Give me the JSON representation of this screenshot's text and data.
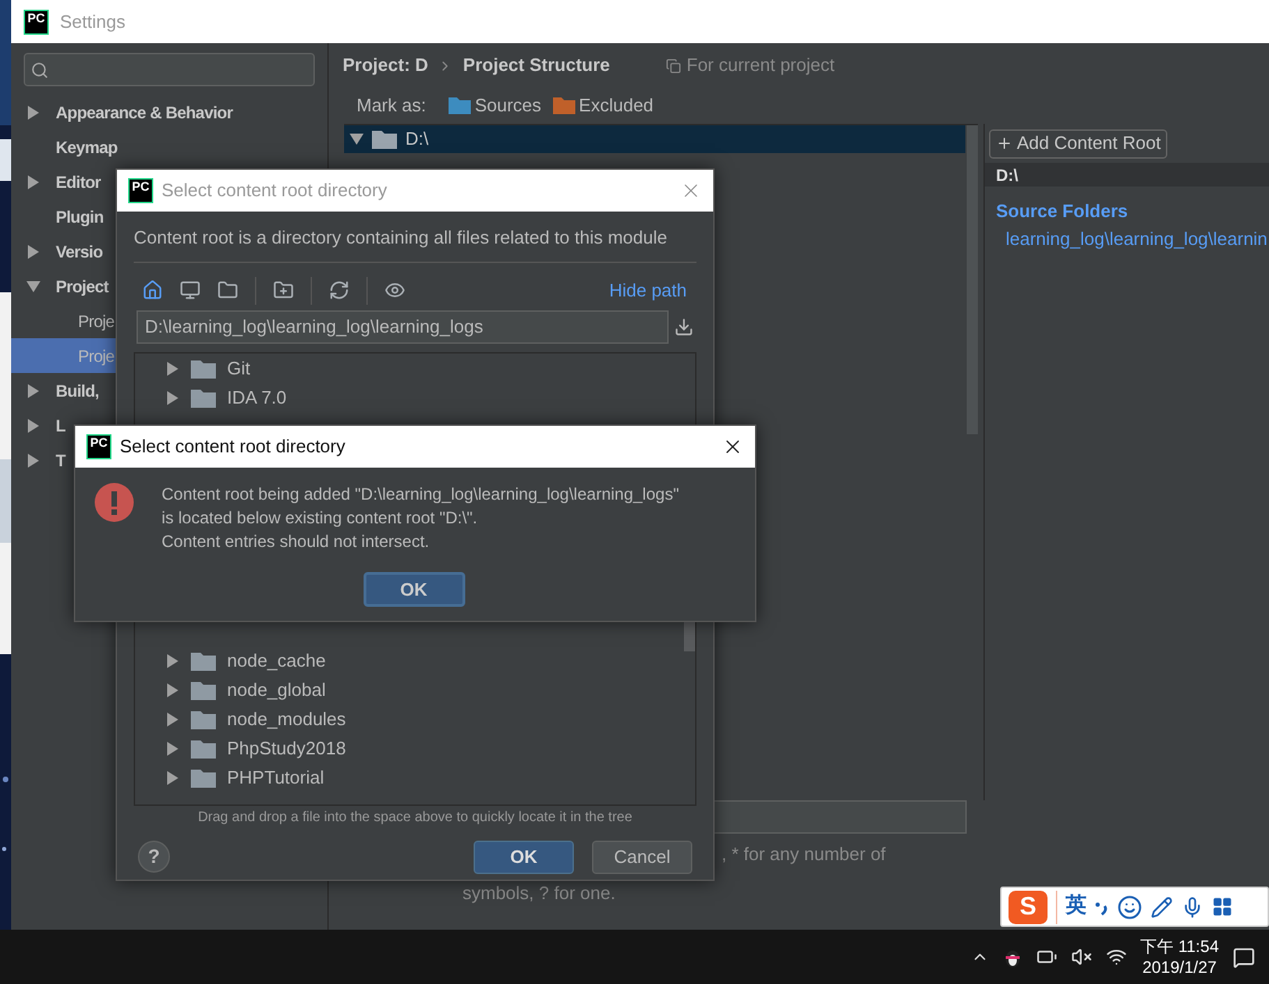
{
  "settings_window": {
    "logo": "PC",
    "title": "Settings",
    "sidebar": {
      "items": [
        {
          "label": "Appearance & Behavior",
          "kind": "group",
          "expanded": false,
          "selected": false
        },
        {
          "label": "Keymap",
          "kind": "page",
          "selected": false
        },
        {
          "label": "Editor",
          "kind": "group",
          "expanded": false,
          "selected": false
        },
        {
          "label": "Plugin",
          "kind": "page",
          "selected": false
        },
        {
          "label": "Versio",
          "kind": "group",
          "expanded": false,
          "selected": false
        },
        {
          "label": "Project",
          "kind": "group",
          "expanded": true,
          "selected": false,
          "children": [
            {
              "label": "Proje",
              "selected": false
            },
            {
              "label": "Proje",
              "selected": true
            }
          ]
        },
        {
          "label": "Build,",
          "kind": "group",
          "expanded": false,
          "selected": false
        },
        {
          "label": "L",
          "kind": "group",
          "expanded": false,
          "selected": false
        },
        {
          "label": "T",
          "kind": "group",
          "expanded": false,
          "selected": false
        }
      ]
    },
    "breadcrumb": [
      "Project: D",
      "Project Structure"
    ],
    "scope_note": "For current project",
    "mark_as": {
      "label": "Mark as:",
      "options": [
        {
          "label": "Sources",
          "color": "#3d8cbf"
        },
        {
          "label": "Excluded",
          "color": "#c0602a"
        }
      ]
    },
    "tree": {
      "items": [
        {
          "label": "D:\\",
          "expanded": true,
          "selected": true
        }
      ]
    },
    "content_root_panel": {
      "add_button": "Add Content Root",
      "root": "D:\\",
      "section_title": "Source Folders",
      "folders": [
        "learning_log\\learning_log\\learnin"
      ]
    },
    "exclude_hint": [
      ", * for any number of",
      "symbols, ? for one."
    ]
  },
  "file_chooser": {
    "logo": "PC",
    "title": "Select content root directory",
    "description": "Content root is a directory containing all files related to this module",
    "hide_path": "Hide path",
    "path": "D:\\learning_log\\learning_log\\learning_logs",
    "tree_top": [
      {
        "label": "Git"
      },
      {
        "label": "IDA 7.0"
      }
    ],
    "tree_bottom": [
      {
        "label": "node_cache"
      },
      {
        "label": "node_global"
      },
      {
        "label": "node_modules"
      },
      {
        "label": "PhpStudy2018"
      },
      {
        "label": "PHPTutorial"
      }
    ],
    "hint": "Drag and drop a file into the space above to quickly locate it in the tree",
    "help": "?",
    "buttons": [
      {
        "label": "OK",
        "kind": "primary"
      },
      {
        "label": "Cancel",
        "kind": "secondary"
      }
    ]
  },
  "error_dialog": {
    "logo": "PC",
    "title": "Select content root directory",
    "lines": [
      "Content root being added \"D:\\learning_log\\learning_log\\learning_logs\"",
      "is located below existing content root \"D:\\\".",
      "Content entries should not intersect."
    ],
    "button": "OK"
  },
  "ime_bar": {
    "logo": "S",
    "language": "英"
  },
  "taskbar": {
    "time": "下午 11:54",
    "date": "2019/1/27"
  }
}
